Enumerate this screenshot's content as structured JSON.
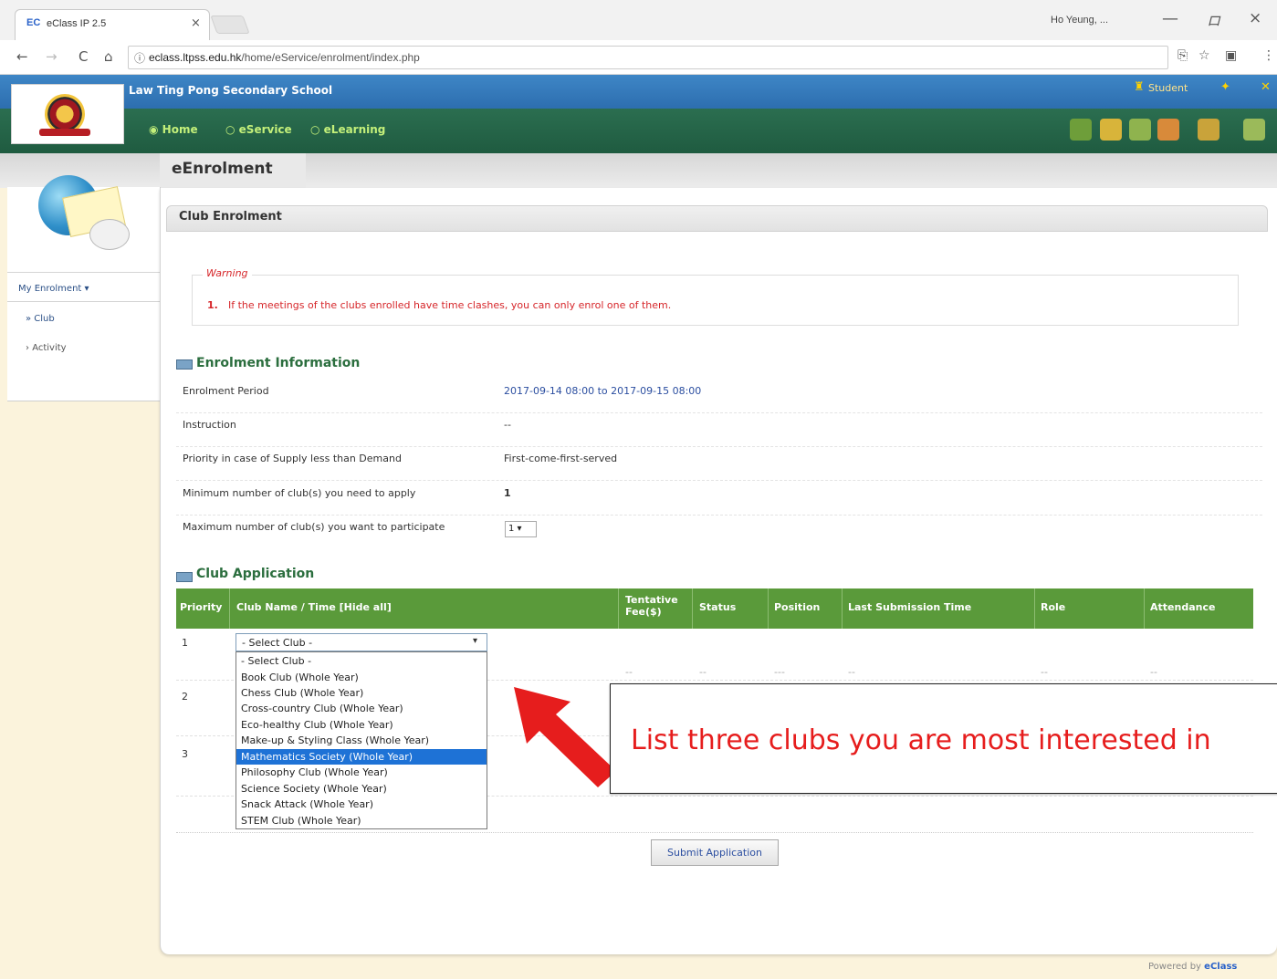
{
  "browser": {
    "tab_favicon": "EC",
    "tab_title": "eClass IP 2.5",
    "tab_close": "×",
    "user_name": "Ho Yeung, ...",
    "minimize": "—",
    "maximize": "ロ",
    "close": "×",
    "url_host": "eclass.ltpss.edu.hk",
    "url_path": "/home/eService/enrolment/index.php",
    "back_icon": "←",
    "forward_icon": "→",
    "reload_icon": "C",
    "home_icon": "⌂",
    "info_icon": "ⓘ"
  },
  "header": {
    "school_name": "Law Ting Pong Secondary School",
    "student_link": "Student",
    "menu": [
      "Home",
      "eService",
      "eLearning"
    ]
  },
  "page": {
    "title": "eEnrolment",
    "section_title": "Club Enrolment"
  },
  "sidebar": {
    "heading": "My Enrolment",
    "items": [
      "Club",
      "Activity"
    ]
  },
  "warning": {
    "legend": "Warning",
    "number": "1.",
    "text": "If the meetings of the clubs enrolled have time clashes, you can only enrol one of them."
  },
  "enrolment_info": {
    "heading": "Enrolment Information",
    "rows": [
      {
        "label": "Enrolment Period",
        "value": "2017-09-14 08:00 to 2017-09-15 08:00"
      },
      {
        "label": "Instruction",
        "value": "--"
      },
      {
        "label": "Priority in case of Supply less than Demand",
        "value": "First-come-first-served"
      },
      {
        "label": "Minimum number of club(s) you need to apply",
        "value": "1"
      },
      {
        "label": "Maximum number of club(s) you want to participate",
        "value": "1"
      }
    ],
    "max_select_value": "1 ▾"
  },
  "club_application": {
    "heading": "Club Application",
    "columns": [
      "Priority",
      "Club Name / Time [Hide all]",
      "Tentative Fee($)",
      "Status",
      "Position",
      "Last Submission Time",
      "Role",
      "Attendance"
    ],
    "rows": [
      "1",
      "2",
      "3"
    ],
    "row1_dashes": [
      "--",
      "--",
      "---",
      "--",
      "--",
      "--"
    ],
    "select_placeholder": "- Select Club -",
    "select_arrow": "▾",
    "options": [
      "- Select Club -",
      "Book Club (Whole Year)",
      "Chess Club (Whole Year)",
      "Cross-country Club (Whole Year)",
      "Eco-healthy Club (Whole Year)",
      "Make-up & Styling Class (Whole Year)",
      "Mathematics Society (Whole Year)",
      "Philosophy Club (Whole Year)",
      "Science Society (Whole Year)",
      "Snack Attack (Whole Year)",
      "STEM Club (Whole Year)"
    ],
    "highlighted_option": "Mathematics Society (Whole Year)",
    "submit_label": "Submit Application"
  },
  "annotation": {
    "text": "List three clubs you are most interested in",
    "arrow_color": "#e61d1d"
  },
  "footer": {
    "powered_prefix": "Powered by",
    "powered_brand": "eClass"
  },
  "colors": {
    "school_bar": "#2d6eaf",
    "menu_bar": "#1f5b40",
    "table_header": "#5a9a3a",
    "warning_text": "#d6262a",
    "selection": "#1e72d6"
  }
}
